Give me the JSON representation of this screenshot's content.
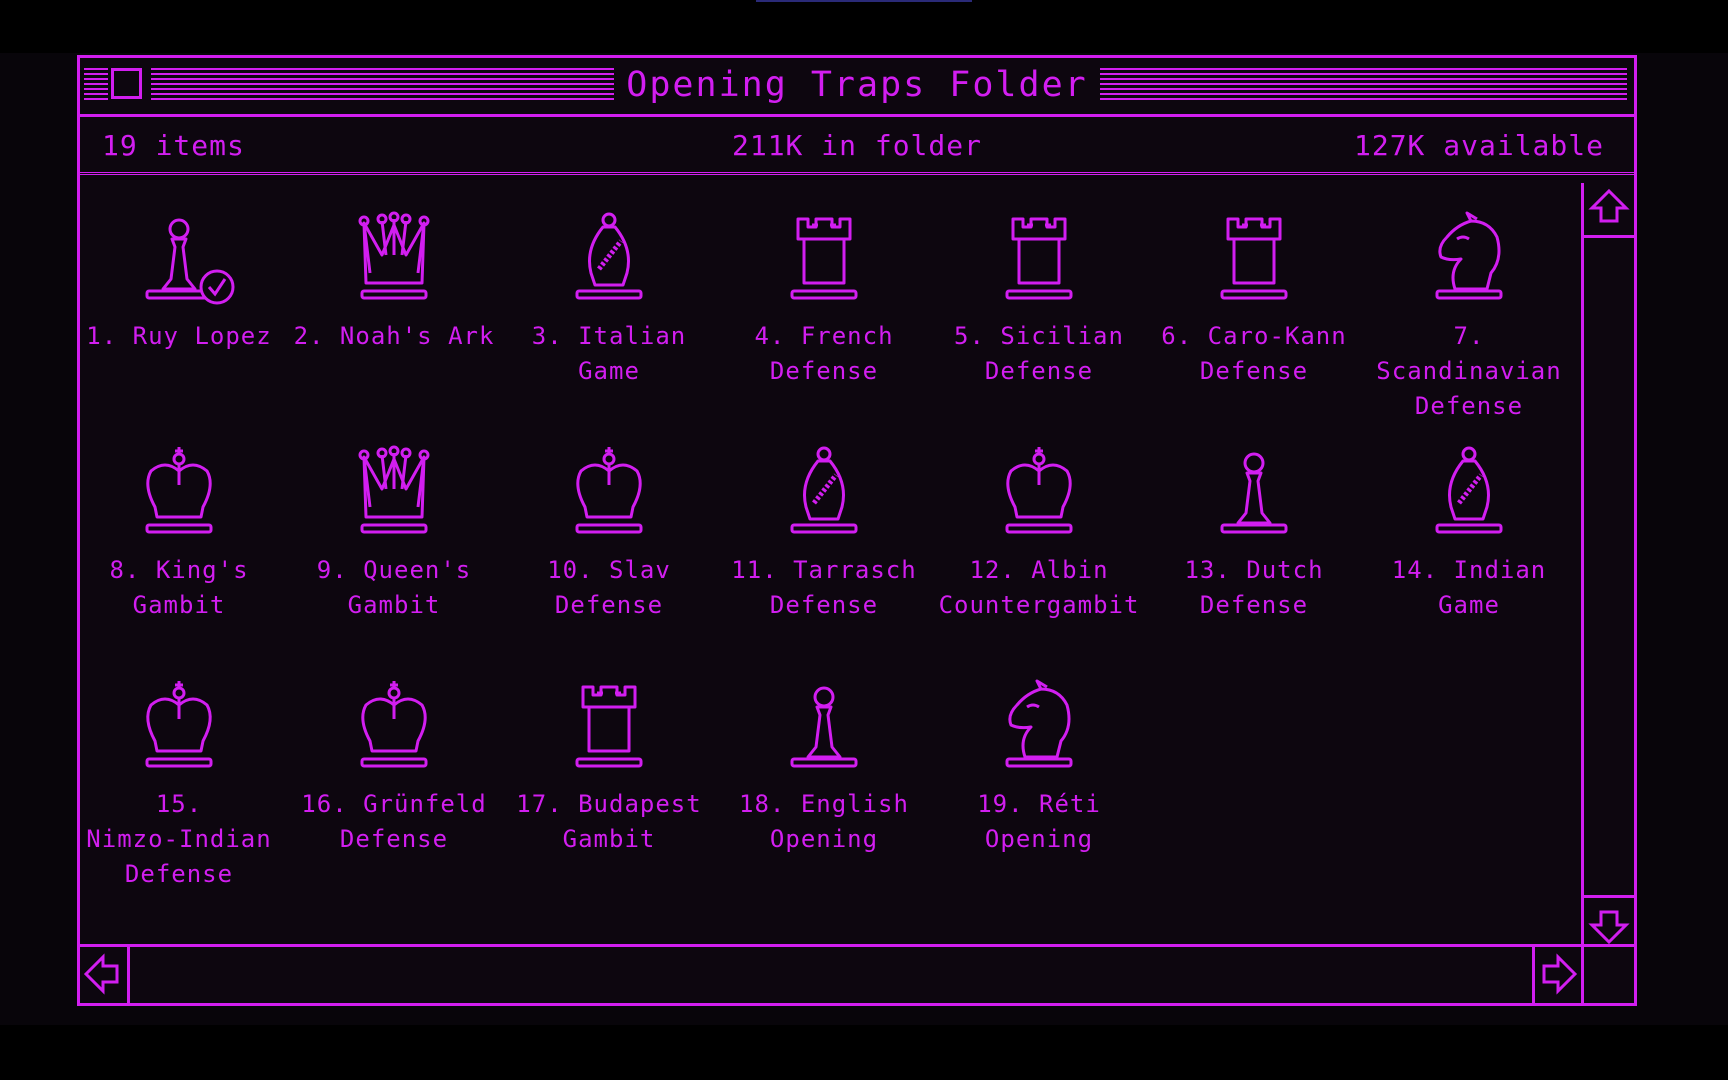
{
  "window": {
    "title": "Opening Traps Folder"
  },
  "infobar": {
    "items": "19 items",
    "size": "211K in folder",
    "available": "127K available"
  },
  "accent_color": "#d21ef0",
  "icons": [
    {
      "label": "1. Ruy Lopez",
      "icon": "pawn-icon",
      "checked": true
    },
    {
      "label": "2. Noah's Ark",
      "icon": "queen-icon"
    },
    {
      "label": "3. Italian Game",
      "icon": "bishop-icon"
    },
    {
      "label": "4. French\nDefense",
      "icon": "rook-icon"
    },
    {
      "label": "5. Sicilian\nDefense",
      "icon": "rook-icon"
    },
    {
      "label": "6. Caro-Kann\nDefense",
      "icon": "rook-icon"
    },
    {
      "label": "7. Scandinavian\nDefense",
      "icon": "knight-icon"
    },
    {
      "label": "8. King's\nGambit",
      "icon": "king-icon"
    },
    {
      "label": "9. Queen's\nGambit",
      "icon": "queen-icon"
    },
    {
      "label": "10. Slav\nDefense",
      "icon": "king-icon"
    },
    {
      "label": "11. Tarrasch\nDefense",
      "icon": "bishop-icon"
    },
    {
      "label": "12. Albin\nCountergambit",
      "icon": "king-icon"
    },
    {
      "label": "13. Dutch\nDefense",
      "icon": "pawn-icon"
    },
    {
      "label": "14. Indian Game",
      "icon": "bishop-icon"
    },
    {
      "label": "15.\nNimzo-Indian\nDefense",
      "icon": "king-icon"
    },
    {
      "label": "16. Grünfeld\nDefense",
      "icon": "king-icon"
    },
    {
      "label": "17. Budapest\nGambit",
      "icon": "rook-icon"
    },
    {
      "label": "18. English\nOpening",
      "icon": "pawn-icon"
    },
    {
      "label": "19. Réti Opening",
      "icon": "knight-icon"
    }
  ]
}
